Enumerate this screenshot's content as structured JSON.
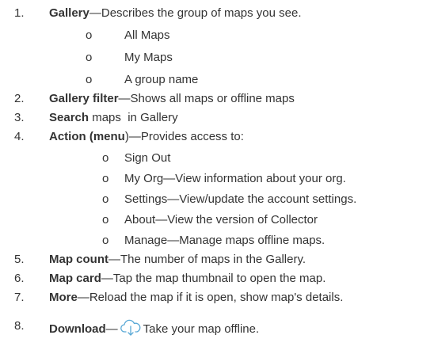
{
  "items": [
    {
      "n": "1.",
      "bold": "Gallery",
      "rest": "—Describes the group of maps you see."
    },
    {
      "n": "2.",
      "bold": "Gallery filter",
      "rest": "—Shows all maps or offline maps"
    },
    {
      "n": "3.",
      "bold": "Search",
      "rest": " maps  in Gallery"
    },
    {
      "n": "4.",
      "bold": "Action (menu",
      "rest": ")—Provides access to:"
    },
    {
      "n": "5.",
      "bold": "Map count",
      "rest": "—The number of maps in the Gallery."
    },
    {
      "n": "6.",
      "bold": "Map card",
      "rest": "—Tap the map thumbnail to open the map."
    },
    {
      "n": "7.",
      "bold": "More",
      "rest": "—Reload the map if it is open, show map's details."
    },
    {
      "n": "8.",
      "bold": "Download",
      "rest_pre": "—",
      "rest": "Take your map offline."
    }
  ],
  "gallery_sub": [
    "All Maps",
    "My Maps",
    "A group name"
  ],
  "action_sub": [
    "Sign Out",
    "My Org—View information about your org.",
    "Settings—View/update the account settings.",
    "About—View the version of Collector",
    "Manage—Manage maps offline maps."
  ],
  "bullet_glyph": "o",
  "icons": {
    "download": "cloud-download-icon"
  },
  "colors": {
    "text": "#333333",
    "icon": "#5aa9d6"
  }
}
